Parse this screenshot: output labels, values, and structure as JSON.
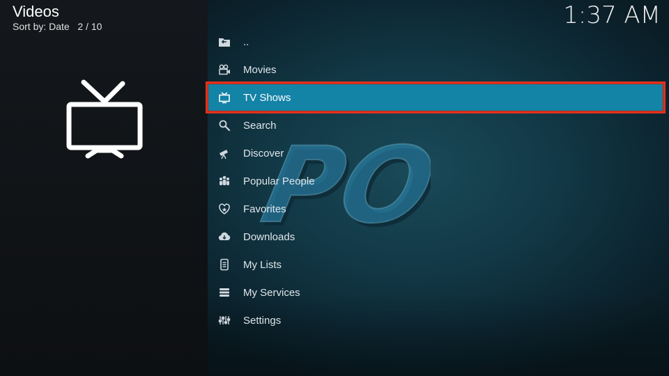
{
  "header": {
    "title": "Videos",
    "sort_label": "Sort by: Date",
    "position": "2 / 10"
  },
  "clock": "1:37 AM",
  "focused_item_icon": "tv-icon",
  "fanart_text": "POV",
  "colors": {
    "focus_bg": "#1383a6",
    "focus_outline": "#e0321e",
    "panel_bg": "#123846"
  },
  "menu": {
    "items": [
      {
        "label": "..",
        "icon": "folder-back-icon"
      },
      {
        "label": "Movies",
        "icon": "movie-camera-icon"
      },
      {
        "label": "TV Shows",
        "icon": "tv-icon",
        "focused": true
      },
      {
        "label": "Search",
        "icon": "search-icon"
      },
      {
        "label": "Discover",
        "icon": "telescope-icon"
      },
      {
        "label": "Popular People",
        "icon": "people-icon"
      },
      {
        "label": "Favorites",
        "icon": "heart-icon"
      },
      {
        "label": "Downloads",
        "icon": "cloud-download-icon"
      },
      {
        "label": "My Lists",
        "icon": "list-icon"
      },
      {
        "label": "My Services",
        "icon": "services-icon"
      },
      {
        "label": "Settings",
        "icon": "sliders-icon"
      }
    ]
  }
}
